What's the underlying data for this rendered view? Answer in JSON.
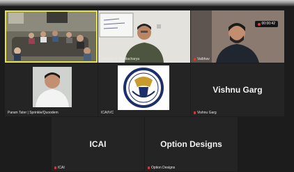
{
  "recording": {
    "time": "00:00:42"
  },
  "tiles": {
    "conference_room": {
      "name": ""
    },
    "presenter": {
      "name": "Samarthak Bhattacharya"
    },
    "participant_beard": {
      "name": "Vaibhav"
    },
    "participant_white_shirt": {
      "name": "Param Tater | Sprinkle/Quoodem"
    },
    "icai_logo_tile": {
      "name": "ICAI/VC"
    },
    "vishnu": {
      "display": "Vishnu Garg",
      "name": "Vishnu Garg"
    },
    "icai": {
      "display": "ICAI",
      "name": "ICAI"
    },
    "option_designs": {
      "display": "Option Designs",
      "name": "Option Designs"
    }
  },
  "colors": {
    "active_speaker": "#e6e44a",
    "tile_bg": "#2b2b2b",
    "muted_mic": "#d93636",
    "icai_logo": "#1c2f6b"
  }
}
